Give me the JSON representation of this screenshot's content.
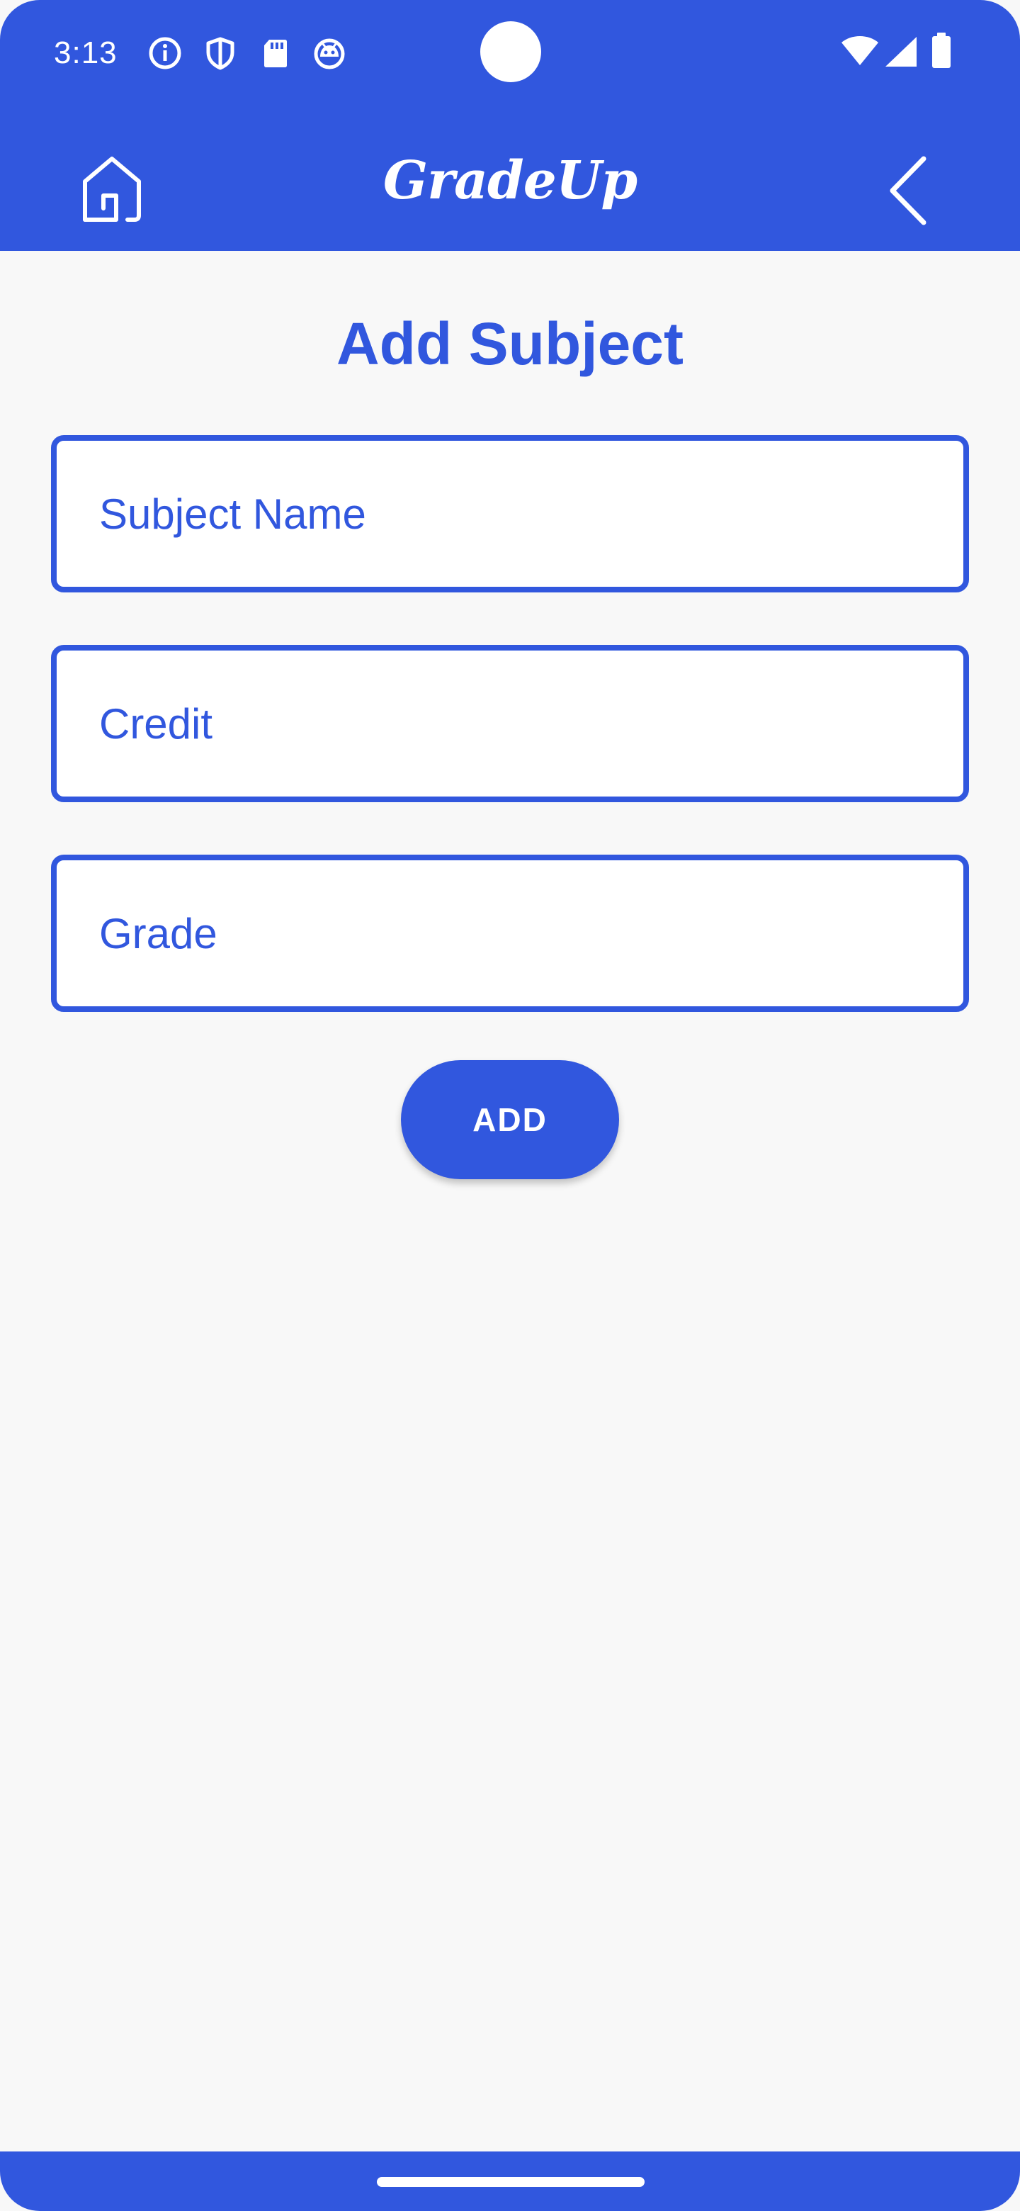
{
  "status_bar": {
    "time": "3:13",
    "left_icons": [
      "info-icon",
      "shield-icon",
      "sd-card-icon",
      "android-debug-icon"
    ],
    "right_icons": [
      "wifi-icon",
      "cellular-signal-icon",
      "battery-icon"
    ]
  },
  "app_bar": {
    "title": "GradeUp",
    "left_icon": "home-icon",
    "right_icon": "back-chevron-icon"
  },
  "page": {
    "title": "Add Subject"
  },
  "form": {
    "subject_name_placeholder": "Subject Name",
    "subject_name_value": "",
    "credit_placeholder": "Credit",
    "credit_value": "",
    "grade_placeholder": "Grade",
    "grade_value": "",
    "add_label": "ADD"
  },
  "colors": {
    "primary": "#3157de",
    "background": "#f8f8f8",
    "field_background": "#ffffff",
    "on_primary": "#ffffff"
  }
}
